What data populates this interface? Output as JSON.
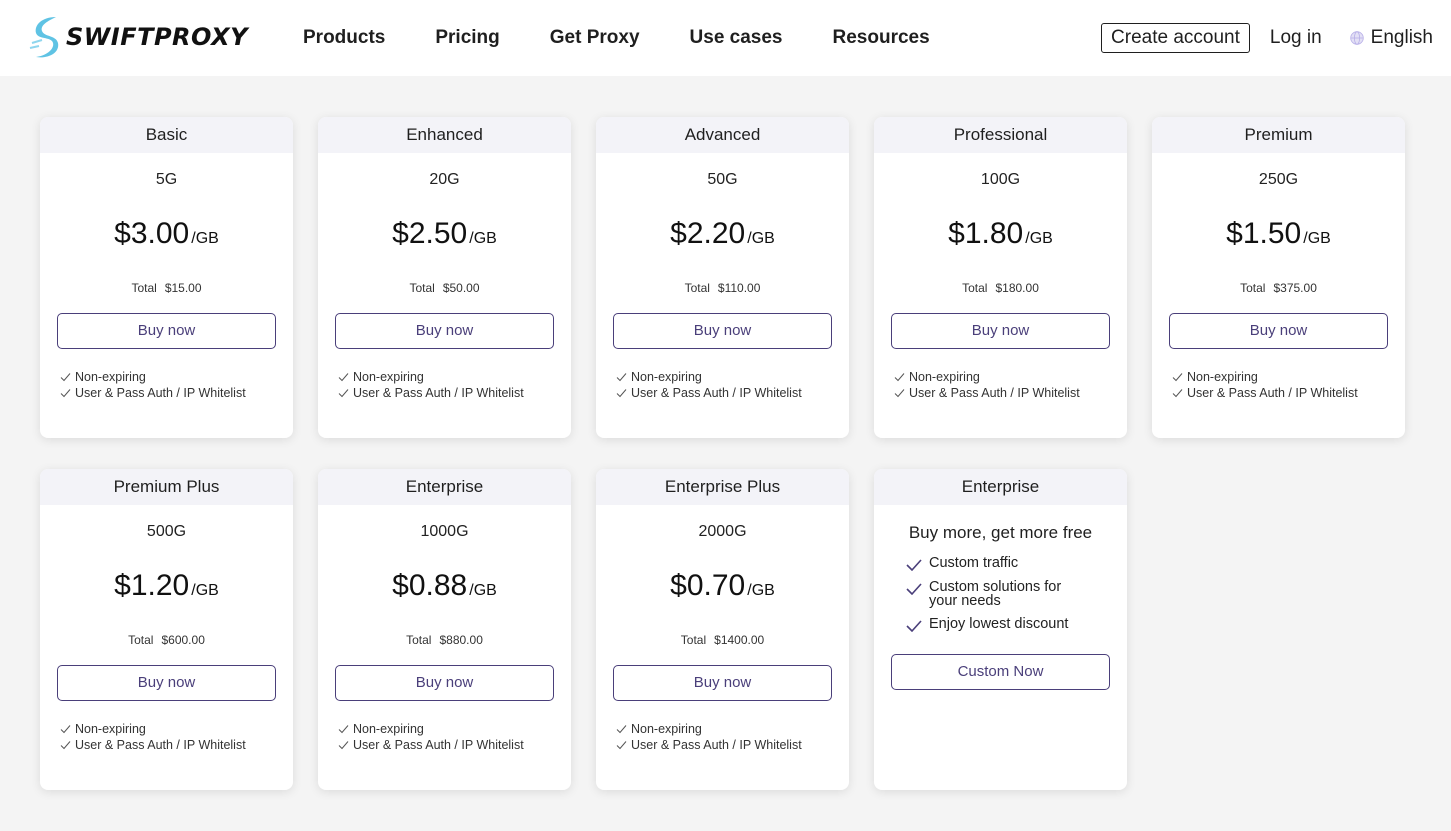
{
  "header": {
    "logo_text": "SWIFTPROXY",
    "nav": [
      "Products",
      "Pricing",
      "Get Proxy",
      "Use cases",
      "Resources"
    ],
    "create_account": "Create account",
    "login": "Log in",
    "language": "English"
  },
  "total_label": "Total",
  "per_unit": "/GB",
  "buy_label": "Buy now",
  "features": [
    "Non-expiring",
    "User & Pass Auth / IP Whitelist"
  ],
  "plans": [
    {
      "name": "Basic",
      "size": "5G",
      "price": "$3.00",
      "total": "$15.00"
    },
    {
      "name": "Enhanced",
      "size": "20G",
      "price": "$2.50",
      "total": "$50.00"
    },
    {
      "name": "Advanced",
      "size": "50G",
      "price": "$2.20",
      "total": "$110.00"
    },
    {
      "name": "Professional",
      "size": "100G",
      "price": "$1.80",
      "total": "$180.00"
    },
    {
      "name": "Premium",
      "size": "250G",
      "price": "$1.50",
      "total": "$375.00"
    },
    {
      "name": "Premium Plus",
      "size": "500G",
      "price": "$1.20",
      "total": "$600.00"
    },
    {
      "name": "Enterprise",
      "size": "1000G",
      "price": "$0.88",
      "total": "$880.00"
    },
    {
      "name": "Enterprise Plus",
      "size": "2000G",
      "price": "$0.70",
      "total": "$1400.00"
    }
  ],
  "custom": {
    "name": "Enterprise",
    "title": "Buy more, get more free",
    "items": [
      "Custom traffic",
      "Custom solutions for your needs",
      "Enjoy lowest discount"
    ],
    "button": "Custom Now"
  },
  "colors": {
    "accent": "#4a3f7a",
    "card_header_bg": "#f3f3f8",
    "page_bg": "#f4f4f4"
  }
}
